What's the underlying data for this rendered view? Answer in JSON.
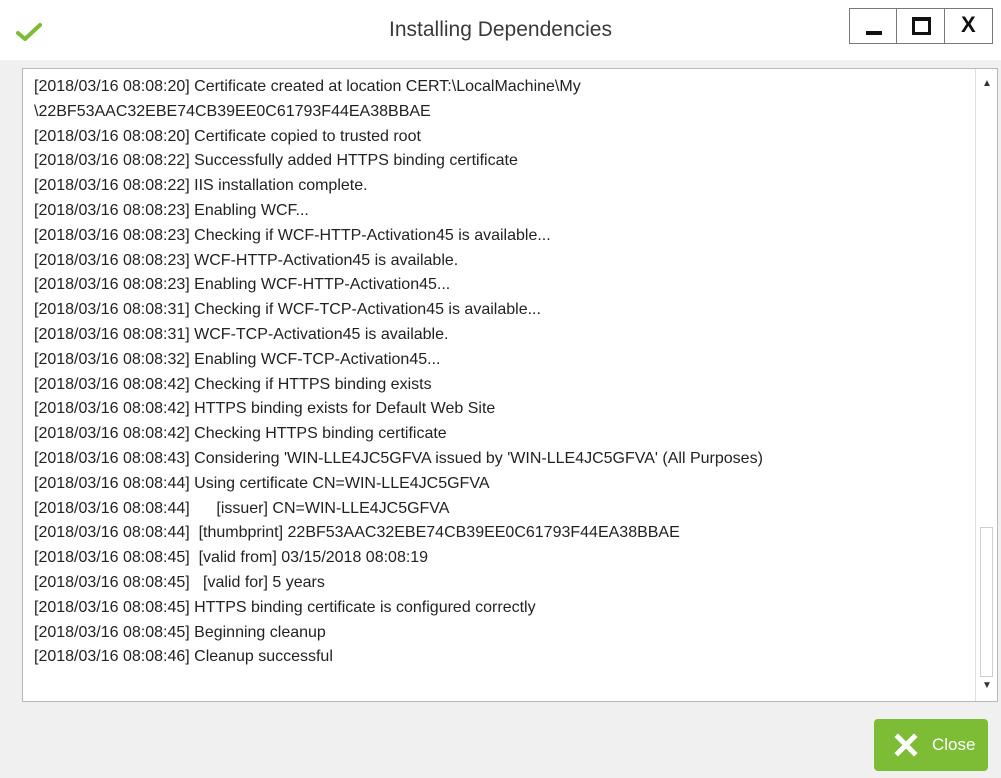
{
  "window": {
    "title": "Installing Dependencies",
    "controls": {
      "minimize": "minimize",
      "maximize": "maximize",
      "close": "X"
    }
  },
  "log": {
    "lines": [
      "[2018/03/16 08:08:20] Certificate created at location CERT:\\LocalMachine\\My",
      "\\22BF53AAC32EBE74CB39EE0C61793F44EA38BBAE",
      "[2018/03/16 08:08:20] Certificate copied to trusted root",
      "[2018/03/16 08:08:22] Successfully added HTTPS binding certificate",
      "[2018/03/16 08:08:22] IIS installation complete.",
      "[2018/03/16 08:08:23] Enabling WCF...",
      "[2018/03/16 08:08:23] Checking if WCF-HTTP-Activation45 is available...",
      "[2018/03/16 08:08:23] WCF-HTTP-Activation45 is available.",
      "[2018/03/16 08:08:23] Enabling WCF-HTTP-Activation45...",
      "[2018/03/16 08:08:31] Checking if WCF-TCP-Activation45 is available...",
      "[2018/03/16 08:08:31] WCF-TCP-Activation45 is available.",
      "[2018/03/16 08:08:32] Enabling WCF-TCP-Activation45...",
      "[2018/03/16 08:08:42] Checking if HTTPS binding exists",
      "[2018/03/16 08:08:42] HTTPS binding exists for Default Web Site",
      "[2018/03/16 08:08:42] Checking HTTPS binding certificate",
      "[2018/03/16 08:08:43] Considering 'WIN-LLE4JC5GFVA issued by 'WIN-LLE4JC5GFVA' (All Purposes)",
      "[2018/03/16 08:08:44] Using certificate CN=WIN-LLE4JC5GFVA",
      "[2018/03/16 08:08:44]      [issuer] CN=WIN-LLE4JC5GFVA",
      "[2018/03/16 08:08:44]  [thumbprint] 22BF53AAC32EBE74CB39EE0C61793F44EA38BBAE",
      "[2018/03/16 08:08:45]  [valid from] 03/15/2018 08:08:19",
      "[2018/03/16 08:08:45]   [valid for] 5 years",
      "[2018/03/16 08:08:45] HTTPS binding certificate is configured correctly",
      "[2018/03/16 08:08:45] Beginning cleanup",
      "[2018/03/16 08:08:46] Cleanup successful"
    ]
  },
  "buttons": {
    "close_label": "Close"
  },
  "icons": {
    "title_status": "checkmark-icon",
    "close_button_icon": "x-icon"
  },
  "colors": {
    "accent_green": "#7cbd35",
    "check_green": "#7cbd35"
  }
}
